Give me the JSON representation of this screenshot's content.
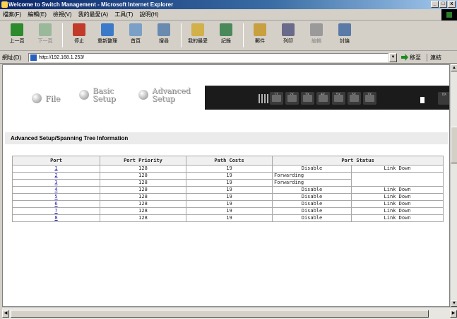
{
  "window": {
    "title": "Welcome to Switch Management - Microsoft Internet Explorer",
    "controls": [
      "_",
      "□",
      "x"
    ]
  },
  "menu": [
    "檔案(F)",
    "編輯(E)",
    "檢視(V)",
    "我的最愛(A)",
    "工具(T)",
    "說明(H)"
  ],
  "toolbar": [
    {
      "label": "上一頁",
      "icon": "back-arrow-icon",
      "color": "#2d8a2d",
      "dim": false
    },
    {
      "label": "下一頁",
      "icon": "forward-arrow-icon",
      "color": "#9ab89a",
      "dim": true
    },
    {
      "label": "停止",
      "icon": "stop-icon",
      "color": "#c23a2a",
      "dim": false
    },
    {
      "label": "重新整理",
      "icon": "refresh-icon",
      "color": "#3a7ac8",
      "dim": false
    },
    {
      "label": "首頁",
      "icon": "home-icon",
      "color": "#7aa0c8",
      "dim": false
    },
    {
      "label": "搜尋",
      "icon": "search-icon",
      "color": "#6a8ab0",
      "dim": false
    },
    {
      "label": "我的最愛",
      "icon": "favorites-icon",
      "color": "#d2b04a",
      "dim": false
    },
    {
      "label": "記錄",
      "icon": "history-icon",
      "color": "#4a8a5a",
      "dim": false
    },
    {
      "label": "郵件",
      "icon": "mail-icon",
      "color": "#c8a040",
      "dim": false
    },
    {
      "label": "列印",
      "icon": "print-icon",
      "color": "#6a6a8a",
      "dim": false
    },
    {
      "label": "編輯",
      "icon": "edit-icon",
      "color": "#9a9a9a",
      "dim": true
    },
    {
      "label": "討論",
      "icon": "discuss-icon",
      "color": "#5a7aa8",
      "dim": false
    }
  ],
  "address": {
    "label": "網址(D)",
    "url": "http://192.168.1.253/",
    "go_label": "移至",
    "links_label": "連結"
  },
  "nav": {
    "file": "File",
    "basic_1": "Basic",
    "basic_2": "Setup",
    "advanced_1": "Advanced",
    "advanced_2": "Setup"
  },
  "switch_panel": {
    "port_numbers": [
      "1T",
      "2X",
      "3X",
      "4X",
      "5X",
      "6X",
      "7X"
    ],
    "last_port_number": "8X"
  },
  "section_title": "Advanced Setup/Spanning Tree Information",
  "table": {
    "headers": [
      "Port",
      "Port Priority",
      "Path Costs",
      "Port Status"
    ],
    "rows": [
      {
        "port": "1",
        "priority": "128",
        "cost": "19",
        "state": "Disable",
        "link": "Link Down"
      },
      {
        "port": "2",
        "priority": "128",
        "cost": "19",
        "state": "Forwarding",
        "link": ""
      },
      {
        "port": "3",
        "priority": "128",
        "cost": "19",
        "state": "Forwarding",
        "link": ""
      },
      {
        "port": "4",
        "priority": "128",
        "cost": "19",
        "state": "Disable",
        "link": "Link Down"
      },
      {
        "port": "5",
        "priority": "128",
        "cost": "19",
        "state": "Disable",
        "link": "Link Down"
      },
      {
        "port": "6",
        "priority": "128",
        "cost": "19",
        "state": "Disable",
        "link": "Link Down"
      },
      {
        "port": "7",
        "priority": "128",
        "cost": "19",
        "state": "Disable",
        "link": "Link Down"
      },
      {
        "port": "8",
        "priority": "128",
        "cost": "19",
        "state": "Disable",
        "link": "Link Down"
      }
    ]
  }
}
